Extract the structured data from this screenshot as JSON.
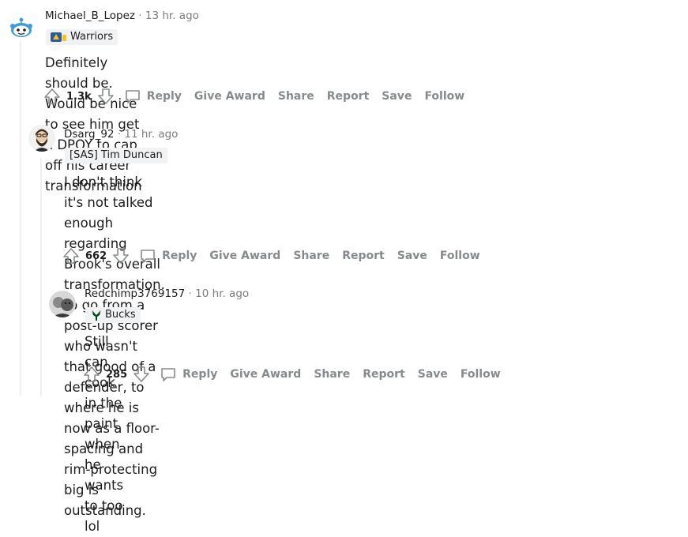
{
  "comments": [
    {
      "username": "Michael_B_Lopez",
      "separator": "·",
      "time": "13 hr. ago",
      "flair": "Warriors",
      "body": "Definitely should be. Would be nice to see him get a DPOY to cap off his career transformation",
      "score": "1.3k",
      "actions": {
        "reply": "Reply",
        "give_award": "Give Award",
        "share": "Share",
        "report": "Report",
        "save": "Save",
        "follow": "Follow"
      }
    },
    {
      "username": "Dsarg_92",
      "separator": "·",
      "time": "11 hr. ago",
      "flair": "[SAS] Tim Duncan",
      "body_lines": [
        "I don't think it's not talked enough regarding Brook's overall transformation. To go from a",
        "post-up scorer who wasn't that good of a defender, to where he is now as a floor-spacing and",
        "rim-protecting big is outstanding."
      ],
      "score": "662",
      "actions": {
        "reply": "Reply",
        "give_award": "Give Award",
        "share": "Share",
        "report": "Report",
        "save": "Save",
        "follow": "Follow"
      }
    },
    {
      "username": "Redchimp3769157",
      "separator": "·",
      "time": "10 hr. ago",
      "flair": "Bucks",
      "body": "Still can cook in the paint when he wants to too lol",
      "score": "285",
      "actions": {
        "reply": "Reply",
        "give_award": "Give Award",
        "share": "Share",
        "report": "Report",
        "save": "Save",
        "follow": "Follow"
      }
    }
  ],
  "colors": {
    "meta_gray": "#7c7c7c",
    "action_gray": "#878a8c",
    "flair_bg": "#f1f2f4",
    "snoo_blue": "#3d9cd9"
  },
  "icons": [
    "reddit-snoo-avatar",
    "user-avatar",
    "upvote-icon",
    "downvote-icon",
    "comment-bubble-icon",
    "warriors-flair-icon",
    "bucks-flair-icon"
  ]
}
